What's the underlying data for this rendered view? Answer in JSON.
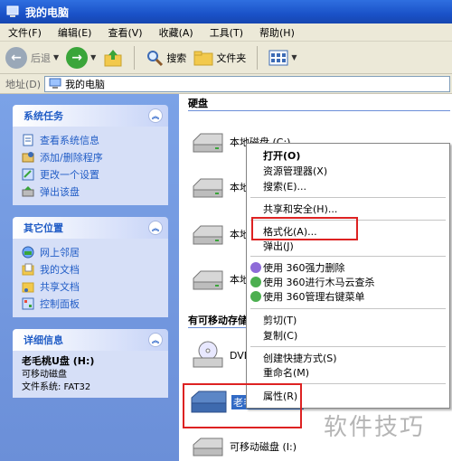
{
  "window": {
    "title": "我的电脑"
  },
  "menubar": [
    "文件(F)",
    "编辑(E)",
    "查看(V)",
    "收藏(A)",
    "工具(T)",
    "帮助(H)"
  ],
  "toolbar": {
    "back_label": "后退",
    "search_label": "搜索",
    "folders_label": "文件夹"
  },
  "address": {
    "label": "地址(D)",
    "value": "我的电脑"
  },
  "system_tasks": {
    "title": "系统任务",
    "items": [
      "查看系统信息",
      "添加/删除程序",
      "更改一个设置",
      "弹出该盘"
    ]
  },
  "other_places": {
    "title": "其它位置",
    "items": [
      "网上邻居",
      "我的文档",
      "共享文档",
      "控制面板"
    ]
  },
  "details": {
    "title": "详细信息",
    "name": "老毛桃U盘 (H:)",
    "type": "可移动磁盘",
    "fs": "文件系统: FAT32"
  },
  "content": {
    "group_hard": "硬盘",
    "group_removable": "有可移动存储",
    "drives": {
      "c": "本地磁盘 (C:)",
      "d": "本地",
      "e": "本地",
      "f": "本地",
      "dvd": "DVD",
      "usb": "老毛桃U盘 (H:)",
      "removable_i": "可移动磁盘 (I:)"
    }
  },
  "context_menu": {
    "open": "打开(O)",
    "explorer": "资源管理器(X)",
    "search": "搜索(E)...",
    "sharing": "共享和安全(H)...",
    "format": "格式化(A)...",
    "eject": "弹出(J)",
    "del360": "使用 360强力删除",
    "scan360": "使用 360进行木马云查杀",
    "manage360": "使用 360管理右键菜单",
    "cut": "剪切(T)",
    "copy": "复制(C)",
    "shortcut": "创建快捷方式(S)",
    "rename": "重命名(M)",
    "properties": "属性(R)"
  },
  "watermark": "软件技巧",
  "colors": {
    "titlebar": "#1a52c8",
    "taskpane": "#6b8fd8",
    "link": "#215dc6",
    "highlight": "#dd2222"
  }
}
